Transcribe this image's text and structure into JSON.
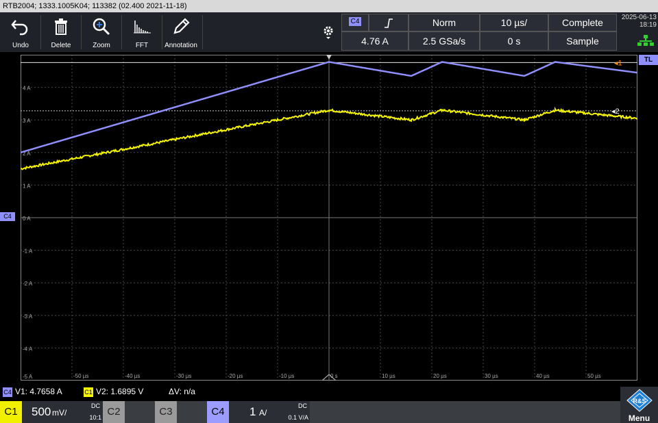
{
  "title_bar": "RTB2004; 1333.1005K04; 113382 (02.400 2021-11-18)",
  "toolbar": {
    "tools": [
      {
        "label": "Undo",
        "icon": "undo-icon"
      },
      {
        "label": "Delete",
        "icon": "trash-icon"
      },
      {
        "label": "Zoom",
        "icon": "zoom-icon"
      },
      {
        "label": "FFT",
        "icon": "fft-icon"
      },
      {
        "label": "Annotation",
        "icon": "pencil-icon"
      }
    ]
  },
  "trigger": {
    "source": "C4",
    "slope_icon": "rising-edge-icon",
    "mode": "Norm",
    "timebase": "10 µs/",
    "acq_state": "Complete",
    "level": "4.76 A",
    "sample_rate": "2.5 GSa/s",
    "position": "0 s",
    "acq_mode": "Sample"
  },
  "datetime": {
    "date": "2025-06-13",
    "time": "18:19"
  },
  "y_axis_labels": [
    "4 A",
    "3 A",
    "2 A",
    "1 A",
    "0 A",
    "-1 A",
    "-2 A",
    "-3 A",
    "-4 A",
    "-5 A"
  ],
  "x_axis_labels": [
    "-50 µs",
    "-40 µs",
    "-30 µs",
    "-20 µs",
    "-10 µs",
    "0 s",
    "10 µs",
    "20 µs",
    "30 µs",
    "40 µs",
    "50 µs"
  ],
  "markers": {
    "ref1": "1",
    "ref2": "2",
    "tl": "TL",
    "channel_left": "C4"
  },
  "cursors": {
    "v1_channel": "C4",
    "v1": "V1: 4.7658 A",
    "v2_channel": "C1",
    "v2": "V2: 1.6895 V",
    "dv": "ΔV: n/a"
  },
  "channels": [
    {
      "name": "C1",
      "scale": "500",
      "unit": "mV/",
      "coupling": "DC",
      "probe": "10:1",
      "color": "#f0f000",
      "active": true
    },
    {
      "name": "C2",
      "active": false
    },
    {
      "name": "C3",
      "active": false
    },
    {
      "name": "C4",
      "scale": "1",
      "unit": "A/",
      "coupling": "DC",
      "probe": "0.1 V/A",
      "color": "#9c9cff",
      "active": true
    }
  ],
  "menu_label": "Menu",
  "colors": {
    "c4": "#8f8fff",
    "c1": "#f5f500",
    "grid": "#4a4a4a",
    "cursor": "#cccccc"
  },
  "waveforms": {
    "c4_A": [
      [
        -60,
        2.0
      ],
      [
        0,
        4.78
      ],
      [
        16,
        4.35
      ],
      [
        22,
        4.78
      ],
      [
        38,
        4.35
      ],
      [
        44,
        4.78
      ],
      [
        60,
        4.45
      ]
    ],
    "c1_A": [
      [
        -60,
        1.5
      ],
      [
        0,
        3.3
      ],
      [
        16,
        3.0
      ],
      [
        22,
        3.3
      ],
      [
        38,
        3.0
      ],
      [
        44,
        3.3
      ],
      [
        60,
        3.05
      ]
    ],
    "cursor_levels_A": [
      4.76,
      3.28
    ]
  }
}
